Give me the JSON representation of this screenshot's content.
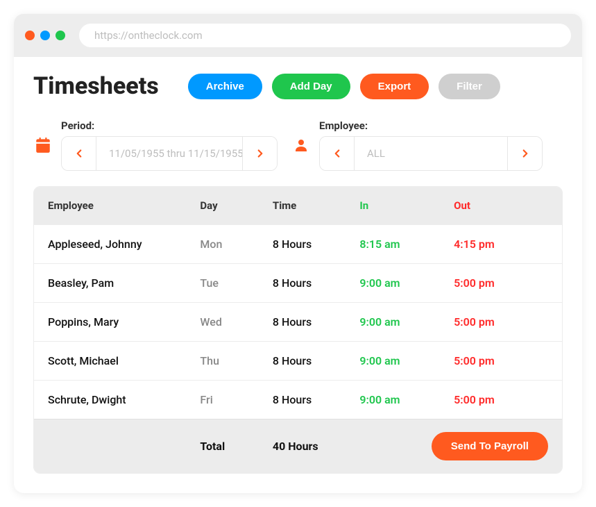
{
  "browser": {
    "url": "https://ontheclock.com"
  },
  "header": {
    "title": "Timesheets",
    "buttons": {
      "archive": "Archive",
      "addDay": "Add Day",
      "export": "Export",
      "filter": "Filter"
    }
  },
  "selectors": {
    "period": {
      "label": "Period:",
      "value": "11/05/1955 thru 11/15/1955"
    },
    "employee": {
      "label": "Employee:",
      "value": "ALL"
    }
  },
  "table": {
    "columns": {
      "employee": "Employee",
      "day": "Day",
      "time": "Time",
      "in": "In",
      "out": "Out"
    },
    "rows": [
      {
        "employee": "Appleseed, Johnny",
        "day": "Mon",
        "time": "8 Hours",
        "in": "8:15 am",
        "out": "4:15 pm"
      },
      {
        "employee": "Beasley, Pam",
        "day": "Tue",
        "time": "8 Hours",
        "in": "9:00 am",
        "out": "5:00 pm"
      },
      {
        "employee": "Poppins, Mary",
        "day": "Wed",
        "time": "8 Hours",
        "in": "9:00 am",
        "out": "5:00 pm"
      },
      {
        "employee": "Scott, Michael",
        "day": "Thu",
        "time": "8 Hours",
        "in": "9:00 am",
        "out": "5:00 pm"
      },
      {
        "employee": "Schrute, Dwight",
        "day": "Fri",
        "time": "8 Hours",
        "in": "9:00 am",
        "out": "5:00 pm"
      }
    ],
    "footer": {
      "totalLabel": "Total",
      "totalValue": "40 Hours",
      "sendButton": "Send To Payroll"
    }
  }
}
